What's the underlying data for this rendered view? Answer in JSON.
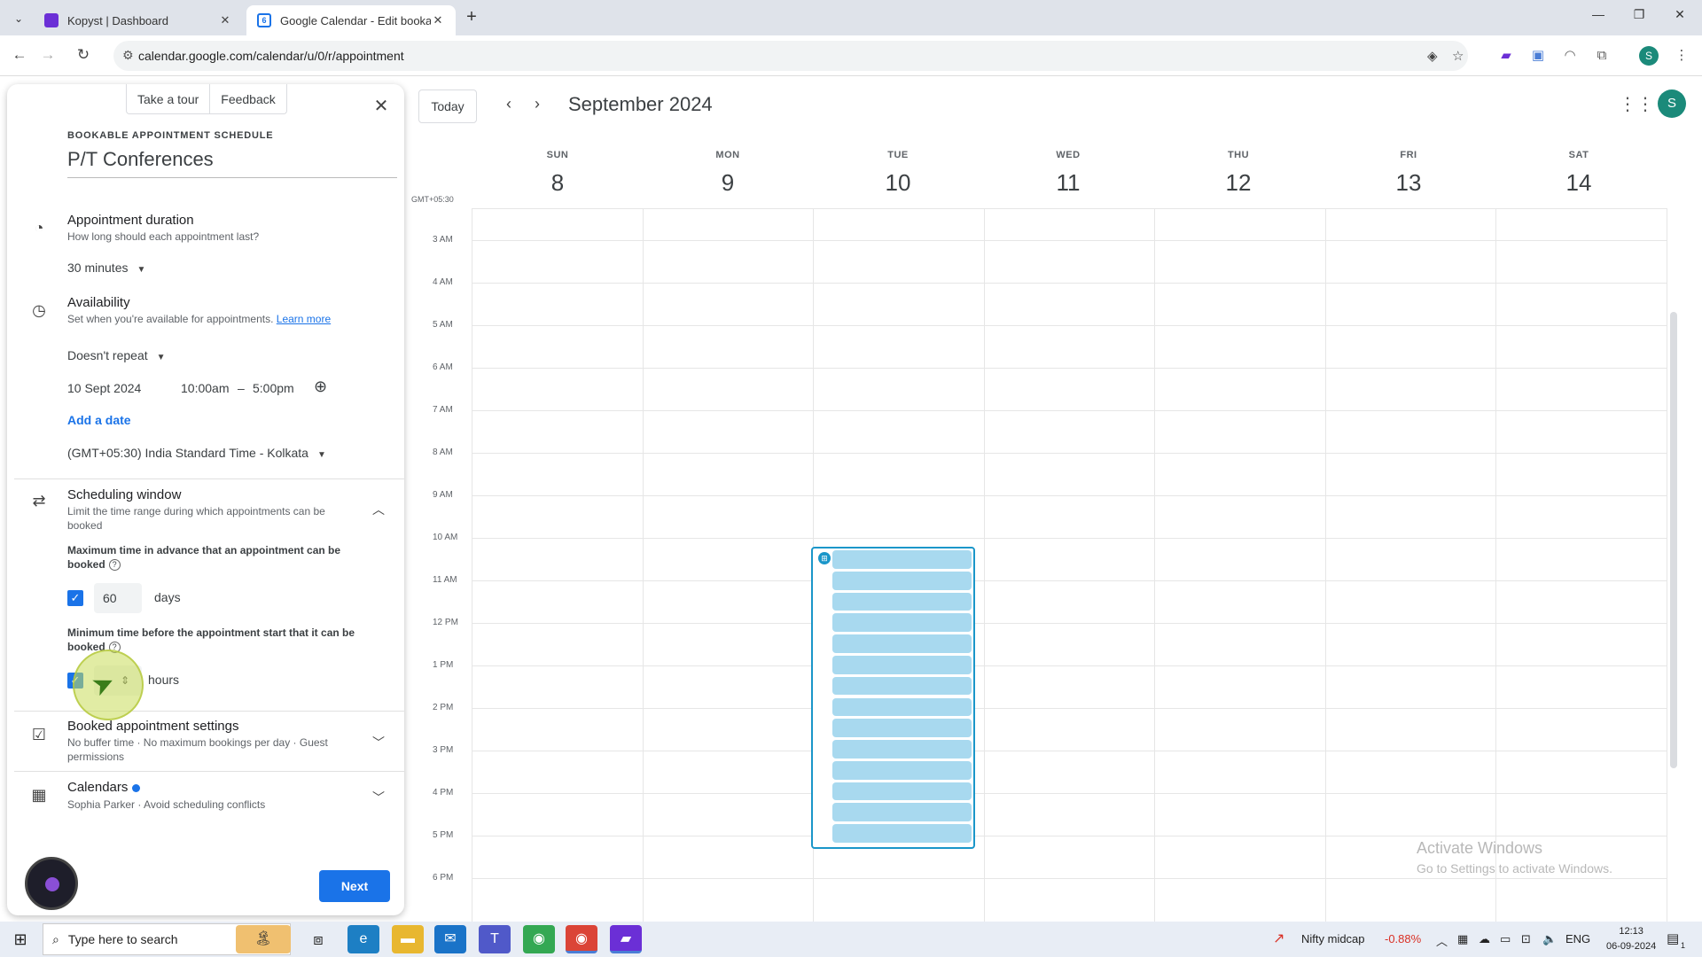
{
  "browser": {
    "tabs": [
      {
        "title": "Kopyst | Dashboard",
        "active": false
      },
      {
        "title": "Google Calendar - Edit bookab",
        "active": true
      }
    ],
    "url": "calendar.google.com/calendar/u/0/r/appointment",
    "profile_initial": "S"
  },
  "panel": {
    "tour_label": "Take a tour",
    "feedback_label": "Feedback",
    "section_label": "BOOKABLE APPOINTMENT SCHEDULE",
    "title": "P/T Conferences",
    "duration": {
      "heading": "Appointment duration",
      "desc": "How long should each appointment last?",
      "value": "30 minutes"
    },
    "availability": {
      "heading": "Availability",
      "desc": "Set when you're available for appointments.",
      "learn_more": "Learn more",
      "repeat": "Doesn't repeat",
      "date": "10 Sept 2024",
      "start": "10:00am",
      "dash": "–",
      "end": "5:00pm",
      "add_date": "Add a date",
      "timezone": "(GMT+05:30) India Standard Time - Kolkata"
    },
    "scheduling": {
      "heading": "Scheduling window",
      "desc": "Limit the time range during which appointments can be booked",
      "max_label": "Maximum time in advance that an appointment can be booked",
      "max_value": "60",
      "max_unit": "days",
      "min_label": "Minimum time before the appointment start that it can be booked",
      "min_value": "",
      "min_unit": "hours"
    },
    "booked": {
      "heading": "Booked appointment settings",
      "desc": "No buffer time · No maximum bookings per day · Guest permissions"
    },
    "calendars": {
      "heading": "Calendars",
      "desc": "Sophia Parker · Avoid scheduling conflicts"
    },
    "next_label": "Next"
  },
  "calendar": {
    "today_label": "Today",
    "month_title": "September 2024",
    "avatar_initial": "S",
    "tz_label": "GMT+05:30",
    "days": [
      {
        "name": "SUN",
        "num": "8"
      },
      {
        "name": "MON",
        "num": "9"
      },
      {
        "name": "TUE",
        "num": "10"
      },
      {
        "name": "WED",
        "num": "11"
      },
      {
        "name": "THU",
        "num": "12"
      },
      {
        "name": "FRI",
        "num": "13"
      },
      {
        "name": "SAT",
        "num": "14"
      }
    ],
    "hours": [
      "3 AM",
      "4 AM",
      "5 AM",
      "6 AM",
      "7 AM",
      "8 AM",
      "9 AM",
      "10 AM",
      "11 AM",
      "12 PM",
      "1 PM",
      "2 PM",
      "3 PM",
      "4 PM",
      "5 PM",
      "6 PM"
    ],
    "slot_count": 14
  },
  "watermark": {
    "line1": "Activate Windows",
    "line2": "Go to Settings to activate Windows."
  },
  "taskbar": {
    "search_placeholder": "Type here to search",
    "stock_name": "Nifty midcap",
    "stock_change": "-0.88%",
    "lang": "ENG",
    "time": "12:13",
    "date": "06-09-2024",
    "notif_count": "1"
  },
  "colors": {
    "accent": "#1a73e8",
    "slot_fill": "#a8d9ef",
    "slot_border": "#1a96c9",
    "stock_negative": "#d93025"
  }
}
